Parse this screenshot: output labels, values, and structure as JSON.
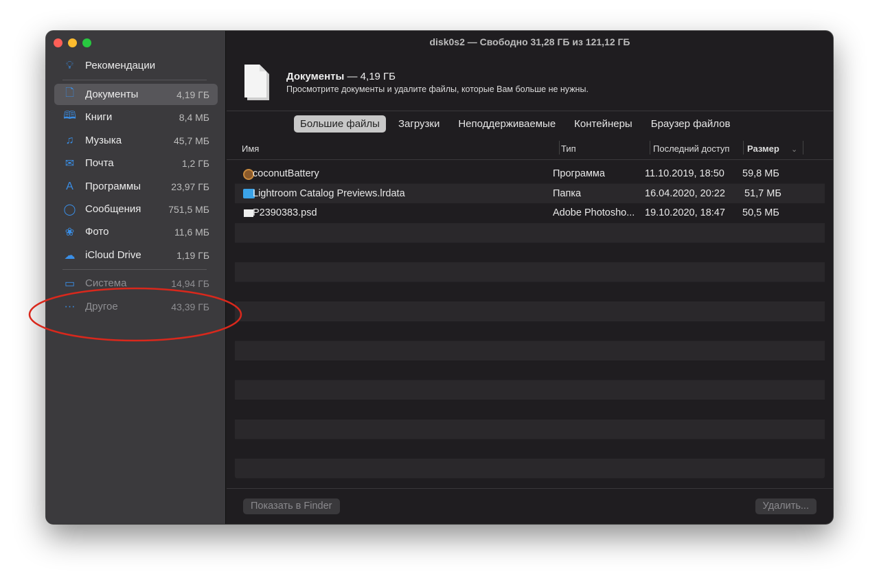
{
  "window": {
    "title": "disk0s2 — Свободно 31,28 ГБ из 121,12 ГБ"
  },
  "sidebar": {
    "recommendations": "Рекомендации",
    "items": [
      {
        "label": "Документы",
        "size": "4,19 ГБ",
        "icon": "document-icon"
      },
      {
        "label": "Книги",
        "size": "8,4 МБ",
        "icon": "book-icon"
      },
      {
        "label": "Музыка",
        "size": "45,7 МБ",
        "icon": "music-icon"
      },
      {
        "label": "Почта",
        "size": "1,2 ГБ",
        "icon": "mail-icon"
      },
      {
        "label": "Программы",
        "size": "23,97 ГБ",
        "icon": "app-store-icon"
      },
      {
        "label": "Сообщения",
        "size": "751,5 МБ",
        "icon": "message-icon"
      },
      {
        "label": "Фото",
        "size": "11,6 МБ",
        "icon": "photos-icon"
      },
      {
        "label": "iCloud Drive",
        "size": "1,19 ГБ",
        "icon": "cloud-icon"
      }
    ],
    "system": [
      {
        "label": "Система",
        "size": "14,94 ГБ"
      },
      {
        "label": "Другое",
        "size": "43,39 ГБ"
      }
    ]
  },
  "header": {
    "title": "Документы",
    "size": "— 4,19 ГБ",
    "subtitle": "Просмотрите документы и удалите файлы, которые Вам больше не нужны."
  },
  "tabs": [
    "Большие файлы",
    "Загрузки",
    "Неподдерживаемые",
    "Контейнеры",
    "Браузер файлов"
  ],
  "columns": {
    "name": "Имя",
    "type": "Тип",
    "accessed": "Последний доступ",
    "size": "Размер"
  },
  "files": [
    {
      "name": "coconutBattery",
      "type": "Программа",
      "accessed": "11.10.2019, 18:50",
      "size": "59,8 МБ"
    },
    {
      "name": "Lightroom Catalog Previews.lrdata",
      "type": "Папка",
      "accessed": "16.04.2020, 20:22",
      "size": "51,7 МБ"
    },
    {
      "name": "P2390383.psd",
      "type": "Adobe Photosho...",
      "accessed": "19.10.2020, 18:47",
      "size": "50,5 МБ"
    }
  ],
  "footer": {
    "show_finder": "Показать в Finder",
    "delete": "Удалить..."
  },
  "colors": {
    "accent": "#3a8ee6",
    "annotation": "#d9281c"
  }
}
